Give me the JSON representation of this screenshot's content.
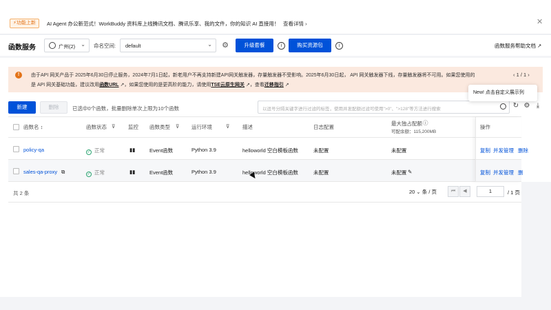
{
  "announcement": {
    "badge": "⚡功能上新",
    "text": "AI Agent 办公新范式！WorkBuddy 资料库上线腾讯文档、腾讯乐享、我的文件，你的知识 AI 直接用！",
    "link": "查看详情 ›",
    "close_icon": "close-icon"
  },
  "header": {
    "title": "函数服务",
    "region": "广州(2)",
    "namespace_label": "命名空间:",
    "namespace": "default",
    "upgrade_button": "升级套餐",
    "buy_button": "购买资源包",
    "help": "函数服务帮助文档 ↗"
  },
  "notice": {
    "line1": "由于API 网关产品于 2025年6月30日停止服务，2024年7月1日起，新老用户不再支持新建API网关触发器，存量触发器不受影响。2025年6月30日起， API 网关触发器下线，存量触发器将不可用。如果您使用的",
    "line2_a": "是 API 网关基础功能，建议改用",
    "line2_link1": "函数URL",
    "line2_b": " ↗，如果您使用的是更高阶的能力，请使用",
    "line2_link2": "TSE云原生网关",
    "line2_c": " ↗，查看",
    "line2_link3": "迁移指引",
    "line2_d": " ↗",
    "pager": "‹ 1 / 1 ›"
  },
  "tooltip": "New! 点击自定义展示列",
  "toolbar": {
    "new_button": "新建",
    "delete_button": "删除",
    "selection_info": "已选中0个函数，批量删除单次上限为10个函数",
    "search_placeholder": "以逗号分隔关键字进行过滤的标签，使用并发配额过滤可使用\">0\"、\">128\"等方法进行搜索"
  },
  "table": {
    "columns": [
      "函数名 ↕",
      "函数状态",
      "监控",
      "函数类型",
      "运行环境",
      "描述",
      "日志配置",
      "最大独占配额",
      "操作"
    ],
    "quota_sub": "可配余额：115,200MB",
    "rows": [
      {
        "name": "policy-qa",
        "status": "正常",
        "type": "Event函数",
        "runtime": "Python 3.9",
        "desc": "helloworld 空白模板函数",
        "log": "未配置",
        "quota": "未配置",
        "op1": "复制",
        "op2": "并发管理",
        "op3": "删除"
      },
      {
        "name": "sales-qa-proxy",
        "status": "正常",
        "type": "Event函数",
        "runtime": "Python 3.9",
        "desc": "helloworld 空白模板函数",
        "log": "未配置",
        "quota": "未配置",
        "op1": "复制",
        "op2": "并发管理",
        "op3": "删"
      }
    ]
  },
  "pagination": {
    "total": "共 2 条",
    "page_size": "20 ⌄ 条 / 页",
    "page": "1",
    "total_pages": "/ 1 页"
  }
}
